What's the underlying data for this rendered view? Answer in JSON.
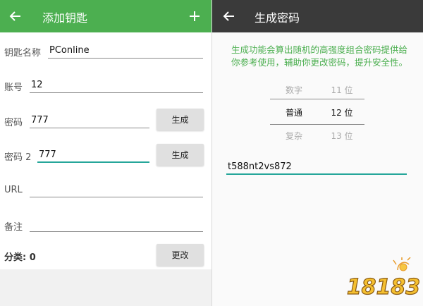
{
  "left_panel": {
    "title": "添加钥匙",
    "fields": {
      "name": {
        "label": "钥匙名称",
        "value": "PConline"
      },
      "account": {
        "label": "账号",
        "value": "12"
      },
      "password": {
        "label": "密码",
        "value": "777",
        "button": "生成"
      },
      "password2": {
        "label": "密码 2",
        "value": "777",
        "button": "生成"
      },
      "url": {
        "label": "URL",
        "value": ""
      },
      "note": {
        "label": "备注",
        "value": ""
      },
      "category": {
        "label": "分类: 0",
        "button": "更改"
      }
    }
  },
  "right_panel": {
    "title": "生成密码",
    "description_line1": "生成功能会算出随机的高强度组合密码提供给",
    "description_line2": "你参考使用，辅助你更改密码，提升安全性。",
    "picker": {
      "types": [
        "数字",
        "普通",
        "复杂"
      ],
      "lengths": [
        "11 位",
        "12 位",
        "13 位"
      ],
      "selected_index": 1
    },
    "generated_password": "t588nt2vs872"
  },
  "colors": {
    "green_bar": "#4caf50",
    "dark_bar": "#3a3a3a",
    "accent_line": "#26a69a",
    "text_green": "#4caf50"
  },
  "watermark": {
    "text": "18183"
  }
}
